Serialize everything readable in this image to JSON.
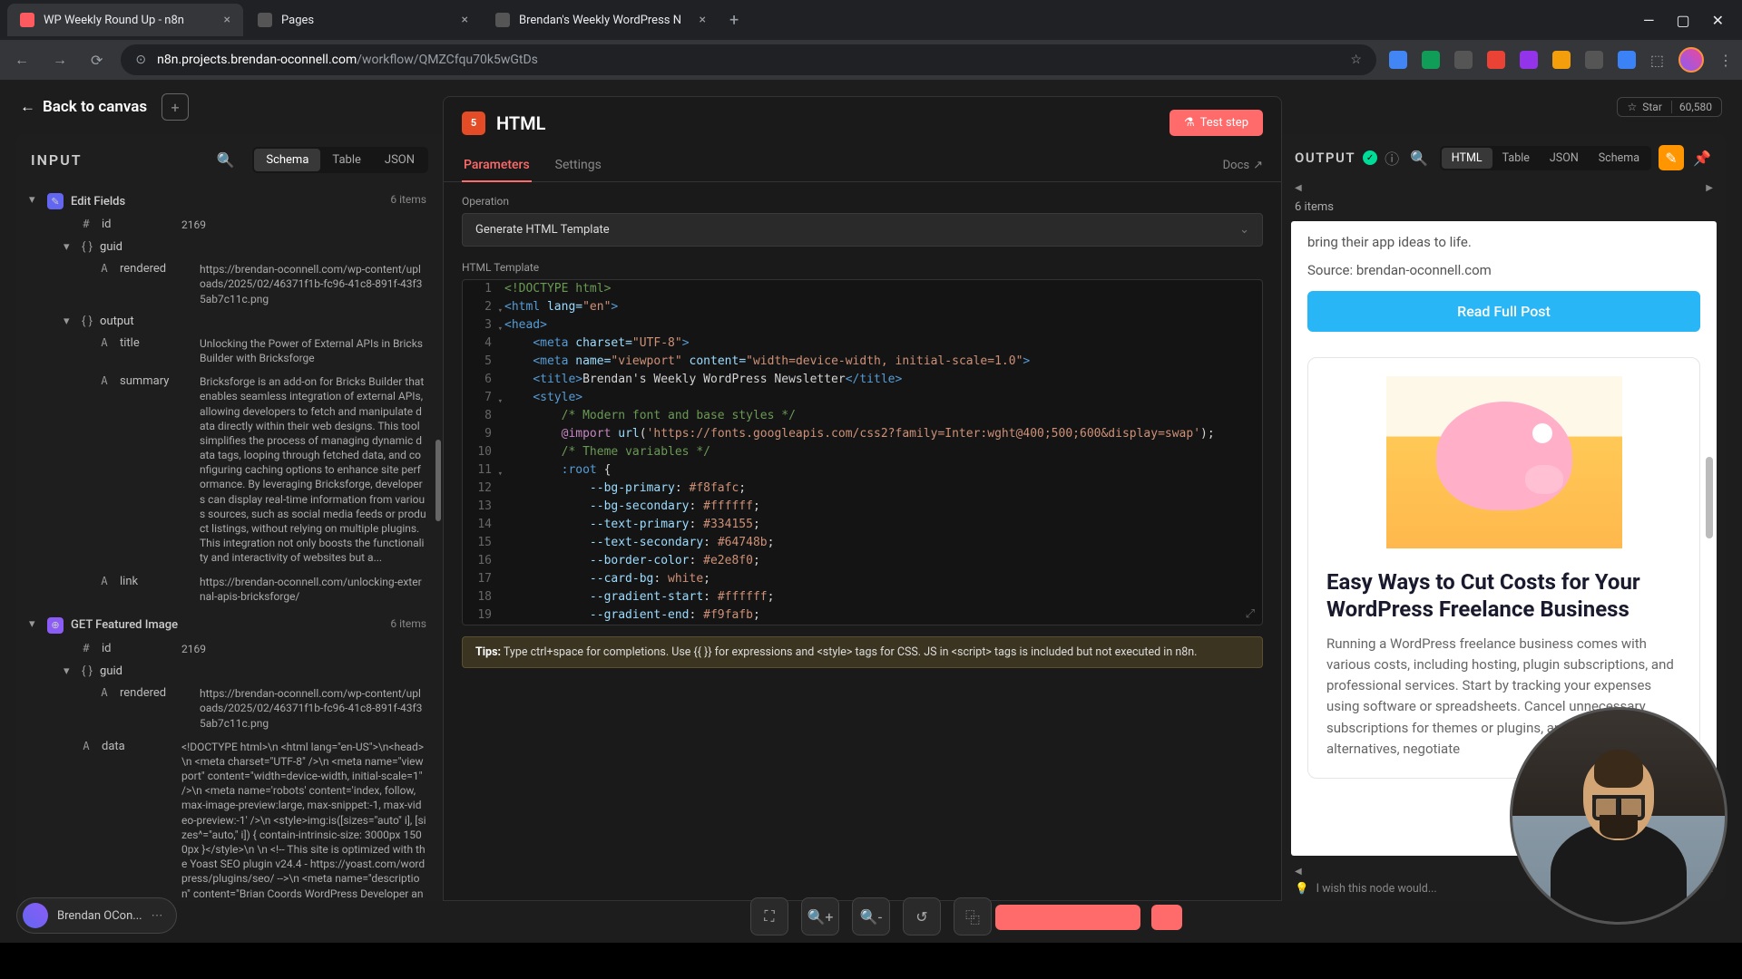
{
  "browser": {
    "tabs": [
      {
        "title": "WP Weekly Round Up - n8n",
        "active": true
      },
      {
        "title": "Pages",
        "active": false
      },
      {
        "title": "Brendan's Weekly WordPress N",
        "active": false
      }
    ],
    "url_domain": "n8n.projects.brendan-oconnell.com",
    "url_path": "/workflow/QMZCfqu70k5wGtDs"
  },
  "back_label": "Back to canvas",
  "github": {
    "star": "Star",
    "count": "60,580"
  },
  "input": {
    "title": "INPUT",
    "views": [
      "Schema",
      "Table",
      "JSON"
    ],
    "active_view": "Schema",
    "node1": {
      "name": "Edit Fields",
      "items": "6 items"
    },
    "f_id": {
      "type": "#",
      "name": "id",
      "val": "2169"
    },
    "f_guid": {
      "name": "guid"
    },
    "f_rendered": {
      "type": "A",
      "name": "rendered",
      "val": "https://brendan-oconnell.com/wp-content/uploads/2025/02/46371f1b-fc96-41c8-891f-43f35ab7c11c.png"
    },
    "f_output": {
      "name": "output"
    },
    "f_title": {
      "type": "A",
      "name": "title",
      "val": "Unlocking the Power of External APIs in Bricks Builder with Bricksforge"
    },
    "f_summary": {
      "type": "A",
      "name": "summary",
      "val": "Bricksforge is an add-on for Bricks Builder that enables seamless integration of external APIs, allowing developers to fetch and manipulate data directly within their web designs. This tool simplifies the process of managing dynamic data tags, looping through fetched data, and configuring caching options to enhance site performance. By leveraging Bricksforge, developers can display real-time information from various sources, such as social media feeds or product listings, without relying on multiple plugins. This integration not only boosts the functionality and interactivity of websites but a..."
    },
    "f_link": {
      "type": "A",
      "name": "link",
      "val": "https://brendan-oconnell.com/unlocking-external-apis-bricksforge/"
    },
    "node2": {
      "name": "GET Featured Image",
      "items": "6 items"
    },
    "f2_id": {
      "type": "#",
      "name": "id",
      "val": "2169"
    },
    "f2_guid": {
      "name": "guid"
    },
    "f2_rendered": {
      "type": "A",
      "name": "rendered",
      "val": "https://brendan-oconnell.com/wp-content/uploads/2025/02/46371f1b-fc96-41c8-891f-43f35ab7c11c.png"
    },
    "f2_data": {
      "type": "A",
      "name": "data",
      "val": "<!DOCTYPE html>\\n <html lang=\"en-US\">\\n<head>\\n  <meta charset=\"UTF-8\" />\\n <meta name=\"viewport\" content=\"width=device-width, initial-scale=1\" />\\n  <meta name='robots' content='index, follow, max-image-preview:large, max-snippet:-1, max-video-preview:-1' />\\n <style>img:is([sizes=\"auto\" i], [sizes^=\"auto,\" i]) { contain-intrinsic-size: 3000px 1500px }</style>\\n \\n <!-- This site is optimized with the Yoast SEO plugin v24.4 - https://yoast.com/wordpress/plugins/seo/ -->\\n  <meta name=\"description\" content=\"Brian Coords WordPress Developer and Sometimes"
    }
  },
  "center": {
    "title": "HTML",
    "test": "Test step",
    "tabs": [
      "Parameters",
      "Settings"
    ],
    "active_tab": "Parameters",
    "docs": "Docs",
    "op_label": "Operation",
    "op_val": "Generate HTML Template",
    "tmpl_label": "HTML Template",
    "tips": "Type ctrl+space for completions. Use {{  }} for expressions and <style> tags for CSS. JS in <script> tags is included but not executed in n8n.",
    "tips_label": "Tips:"
  },
  "code": {
    "l1": {
      "n": "1",
      "c": "<!DOCTYPE html>",
      "cls": "c-comment"
    },
    "l2": {
      "n": "2"
    },
    "l3": {
      "n": "3"
    },
    "l4": {
      "n": "4"
    },
    "l5": {
      "n": "5"
    },
    "l6": {
      "n": "6"
    },
    "l7": {
      "n": "7"
    },
    "l8": {
      "n": "8",
      "c": "/* Modern font and base styles */"
    },
    "l9": {
      "n": "9"
    },
    "l10": {
      "n": "10",
      "c": "/* Theme variables */"
    },
    "l11": {
      "n": "11"
    },
    "l12": {
      "n": "12"
    },
    "l13": {
      "n": "13"
    },
    "l14": {
      "n": "14"
    },
    "l15": {
      "n": "15"
    },
    "l16": {
      "n": "16"
    },
    "l17": {
      "n": "17"
    },
    "l18": {
      "n": "18"
    },
    "l19": {
      "n": "19"
    }
  },
  "output": {
    "title": "OUTPUT",
    "views": [
      "HTML",
      "Table",
      "JSON",
      "Schema"
    ],
    "active": "HTML",
    "items": "6 items",
    "snippet": "bring their app ideas to life.",
    "source": "Source: brendan-oconnell.com",
    "cta": "Read Full Post",
    "card_title": "Easy Ways to Cut Costs for Your WordPress Freelance Business",
    "card_body": "Running a WordPress freelance business comes with various costs, including hosting, plugin subscriptions, and professional services. Start by tracking your expenses using software or spreadsheets. Cancel unnecessary subscriptions for themes or plugins, and explore cheaper alternatives, negotiate",
    "wish": "I wish this node would..."
  },
  "user": "Brendan OCon..."
}
